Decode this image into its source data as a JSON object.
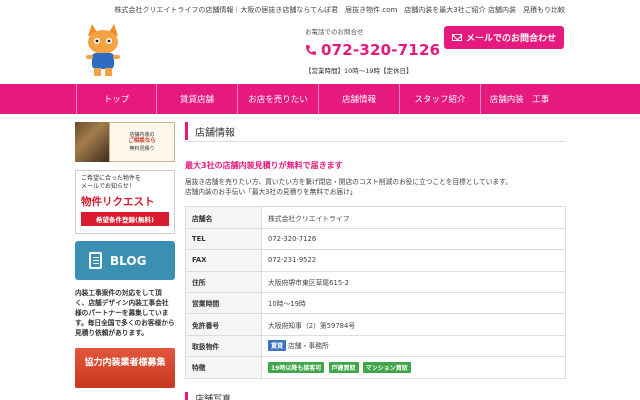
{
  "topbar": "株式会社クリエイトライフの店舗情報｜大阪の居抜き店舗ならてんぽ君　居抜き物件.com　店舗内装を最大3社ご紹介 店舗内装　見積もり比較",
  "contact": {
    "label": "お電話でのお問合せ",
    "phone": "072-320-7126",
    "hours": "【営業時間】10時〜19時【定休日】"
  },
  "mail_button": "メールでのお問合わせ",
  "nav": [
    "トップ",
    "賃貸店舗",
    "お店を売りたい",
    "店舗情報",
    "スタッフ紹介",
    "店舗内装　工事"
  ],
  "sidebar": {
    "banner1": {
      "line1": "店舗内装の",
      "line2": "ご相談なら",
      "line3": "無料見積り"
    },
    "banner2": {
      "line1": "ご希望に合った物件を",
      "line2": "メールでお知らせ！",
      "title": "物件リクエスト",
      "button": "希望条件登録(無料)"
    },
    "blog": "BLOG",
    "partner_text": "内装工事案件の対応をして頂く、店舗デザイン内装工事会社様のパートナーを募集しています。毎日全国で多くのお客様から見積り依頼があります。",
    "partner_button": "協力内装業者様募集"
  },
  "main": {
    "heading": "店舗情報",
    "lead": "最大3社の店舗内装見積りが無料で届きます",
    "body_line1": "居抜き店舗を売りたい方、買いたい方を繋げ閉店・開店のコスト削減のお役に立つことを目標としています。",
    "body_line2": "店舗内装のお手伝い「最大3社の見積りを無料でお届け」",
    "table": [
      {
        "key": "店舗名",
        "value": "株式会社クリエイトライフ"
      },
      {
        "key": "TEL",
        "value": "072-320-7126"
      },
      {
        "key": "FAX",
        "value": "072-231-9522"
      },
      {
        "key": "住所",
        "value": "大阪府堺市東区草尾615-2"
      },
      {
        "key": "営業時間",
        "value": "10時〜19時"
      },
      {
        "key": "免許番号",
        "value": "大阪府知事（2）第59784号"
      }
    ],
    "handled": {
      "key": "取扱物件",
      "tag": "賃貸",
      "value": "店舗・事務所"
    },
    "features": {
      "key": "特徴",
      "tags": [
        "19時以降も接客可",
        "戸建買取",
        "マンション買取"
      ]
    },
    "heading2": "店舗写真"
  },
  "colors": {
    "accent": "#e5197e",
    "blog": "#3b8fb3",
    "partner": "#d0452a",
    "tag_blue": "#3a76c4",
    "tag_green": "#41a64a"
  }
}
